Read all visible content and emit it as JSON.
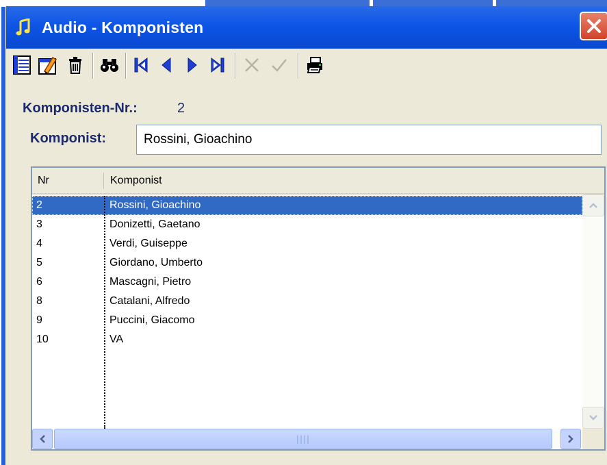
{
  "window": {
    "title": "Audio - Komponisten",
    "accent": "#0a55e6",
    "selection_color": "#316ac5"
  },
  "toolbar": {
    "buttons": [
      {
        "icon": "new-record-icon",
        "enabled": true
      },
      {
        "icon": "edit-record-icon",
        "enabled": true
      },
      {
        "icon": "trash-icon",
        "enabled": true
      },
      {
        "icon": "binoculars-icon",
        "enabled": true
      },
      {
        "icon": "first-record-icon",
        "enabled": true
      },
      {
        "icon": "previous-record-icon",
        "enabled": true
      },
      {
        "icon": "next-record-icon",
        "enabled": true
      },
      {
        "icon": "last-record-icon",
        "enabled": true
      },
      {
        "icon": "cancel-icon",
        "enabled": false
      },
      {
        "icon": "confirm-check-icon",
        "enabled": false
      },
      {
        "icon": "printer-icon",
        "enabled": true
      }
    ]
  },
  "form": {
    "nr_label": "Komponisten-Nr.:",
    "nr_value": "2",
    "komponist_label": "Komponist:",
    "komponist_value": "Rossini, Gioachino"
  },
  "list": {
    "columns": [
      "Nr",
      "Komponist"
    ],
    "rows": [
      {
        "nr": "2",
        "name": "Rossini, Gioachino",
        "selected": true
      },
      {
        "nr": "3",
        "name": "Donizetti, Gaetano",
        "selected": false
      },
      {
        "nr": "4",
        "name": "Verdi, Guiseppe",
        "selected": false
      },
      {
        "nr": "5",
        "name": "Giordano, Umberto",
        "selected": false
      },
      {
        "nr": "6",
        "name": "Mascagni, Pietro",
        "selected": false
      },
      {
        "nr": "8",
        "name": "Catalani, Alfredo",
        "selected": false
      },
      {
        "nr": "9",
        "name": "Puccini, Giacomo",
        "selected": false
      },
      {
        "nr": "10",
        "name": "VA",
        "selected": false
      }
    ]
  }
}
